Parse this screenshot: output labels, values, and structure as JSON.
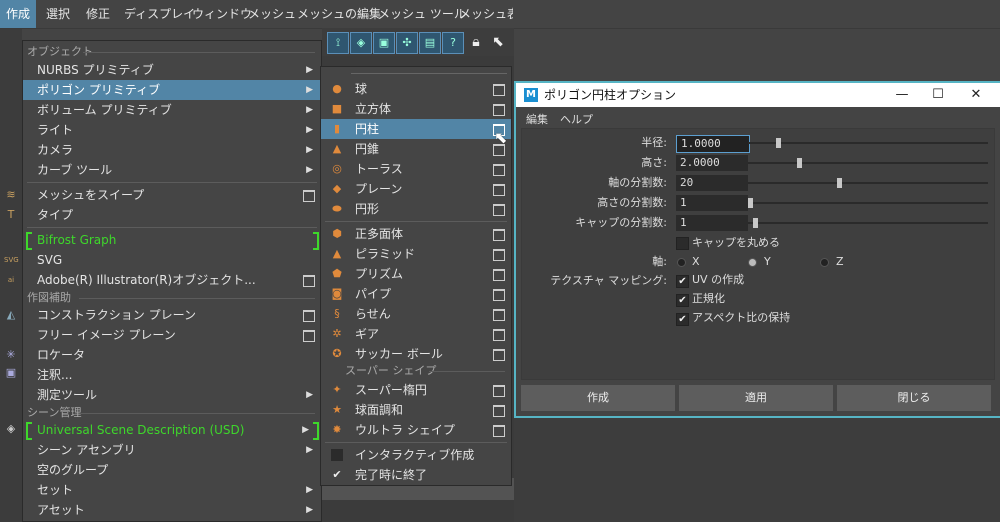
{
  "menubar": {
    "items": [
      "作成",
      "選択",
      "修正",
      "ディスプレイ",
      "ウィンドウ",
      "メッシュ",
      "メッシュの編集",
      "メッシュ ツール",
      "メッシュ表示"
    ]
  },
  "shelf_icons": [
    "?"
  ],
  "create_menu": {
    "sections": {
      "objects": "オブジェクト",
      "construction": "作図補助",
      "scene": "シーン管理"
    },
    "items": [
      {
        "label": "NURBS プリミティブ",
        "type": "arrow"
      },
      {
        "label": "ポリゴン プリミティブ",
        "type": "arrow",
        "highlight": true
      },
      {
        "label": "ボリューム プリミティブ",
        "type": "arrow"
      },
      {
        "label": "ライト",
        "type": "arrow"
      },
      {
        "label": "カメラ",
        "type": "arrow"
      },
      {
        "label": "カーブ ツール",
        "type": "arrow"
      },
      {
        "label": "メッシュをスイープ",
        "type": "box"
      },
      {
        "label": "タイプ",
        "type": "none"
      },
      {
        "label": "Bifrost Graph",
        "type": "green"
      },
      {
        "label": "SVG",
        "type": "none"
      },
      {
        "label": "Adobe(R) Illustrator(R)オブジェクト...",
        "type": "box"
      },
      {
        "label": "コンストラクション プレーン",
        "type": "box"
      },
      {
        "label": "フリー イメージ プレーン",
        "type": "box"
      },
      {
        "label": "ロケータ",
        "type": "none"
      },
      {
        "label": "注釈...",
        "type": "none"
      },
      {
        "label": "測定ツール",
        "type": "arrow"
      },
      {
        "label": "Universal Scene Description (USD)",
        "type": "green-arrow"
      },
      {
        "label": "シーン アセンブリ",
        "type": "arrow"
      },
      {
        "label": "空のグループ",
        "type": "none"
      },
      {
        "label": "セット",
        "type": "arrow"
      },
      {
        "label": "アセット",
        "type": "arrow"
      }
    ]
  },
  "poly_submenu": {
    "section_super": "スーパー シェイプ",
    "items": [
      {
        "label": "球",
        "icon": "sphere-icon"
      },
      {
        "label": "立方体",
        "icon": "cube-icon"
      },
      {
        "label": "円柱",
        "icon": "cylinder-icon",
        "highlight": true
      },
      {
        "label": "円錐",
        "icon": "cone-icon"
      },
      {
        "label": "トーラス",
        "icon": "torus-icon"
      },
      {
        "label": "プレーン",
        "icon": "plane-icon"
      },
      {
        "label": "円形",
        "icon": "disc-icon"
      },
      {
        "label": "正多面体",
        "icon": "platonic-icon"
      },
      {
        "label": "ピラミッド",
        "icon": "pyramid-icon"
      },
      {
        "label": "プリズム",
        "icon": "prism-icon"
      },
      {
        "label": "パイプ",
        "icon": "pipe-icon"
      },
      {
        "label": "らせん",
        "icon": "helix-icon"
      },
      {
        "label": "ギア",
        "icon": "gear-icon"
      },
      {
        "label": "サッカー ボール",
        "icon": "soccer-ball-icon"
      },
      {
        "label": "スーパー楕円",
        "icon": "super-ellipse-icon"
      },
      {
        "label": "球面調和",
        "icon": "spherical-harmonics-icon"
      },
      {
        "label": "ウルトラ シェイプ",
        "icon": "ultra-shape-icon"
      },
      {
        "label": "インタラクティブ作成",
        "icon": "checkbox-empty"
      },
      {
        "label": "完了時に終了",
        "icon": "checkbox-checked"
      }
    ]
  },
  "dialog": {
    "title": "ポリゴン円柱オプション",
    "logo": "M",
    "menu": [
      "編集",
      "ヘルプ"
    ],
    "fields": [
      {
        "label": "半径:",
        "value": "1.0000",
        "slider": 0.12
      },
      {
        "label": "高さ:",
        "value": "2.0000",
        "slider": 0.21
      },
      {
        "label": "軸の分割数:",
        "value": "20",
        "slider": 0.38
      },
      {
        "label": "高さの分割数:",
        "value": "1",
        "slider": 0.0
      },
      {
        "label": "キャップの分割数:",
        "value": "1",
        "slider": 0.02
      }
    ],
    "round_cap": "キャップを丸める",
    "axis_label": "軸:",
    "axis_options": [
      "X",
      "Y",
      "Z"
    ],
    "axis_selected": "Y",
    "texture_label": "テクスチャ マッピング:",
    "checks": [
      {
        "label": "UV の作成",
        "checked": true
      },
      {
        "label": "正規化",
        "checked": true
      },
      {
        "label": "アスペクト比の保持",
        "checked": true
      }
    ],
    "buttons": [
      "作成",
      "適用",
      "閉じる"
    ]
  },
  "colors": {
    "highlight": "#5285a6",
    "green": "#3ed72b",
    "dialog_border": "#56b4c4"
  }
}
